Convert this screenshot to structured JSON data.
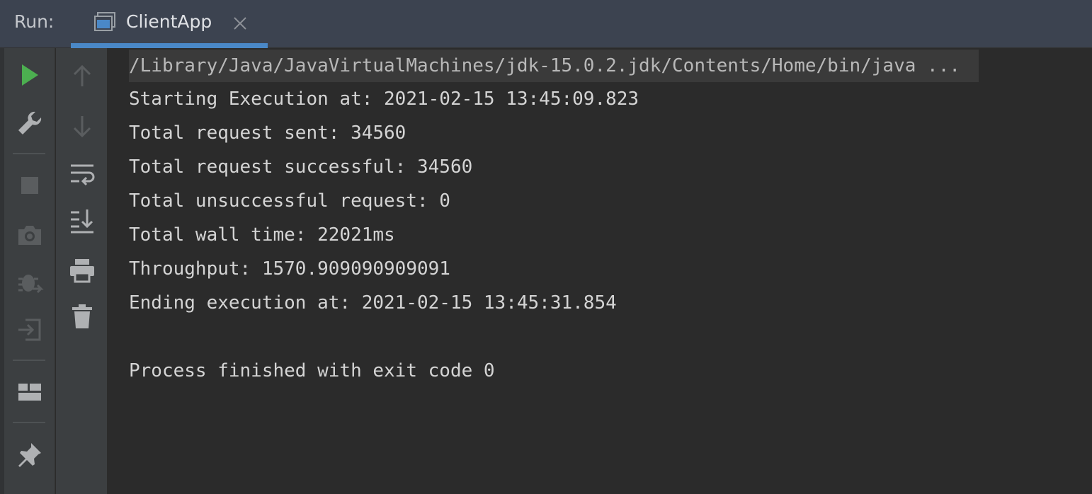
{
  "header": {
    "run_label": "Run:",
    "tab": {
      "title": "ClientApp",
      "icon": "console-window-icon",
      "close_icon": "close-icon"
    },
    "accent_color": "#4a88c7"
  },
  "toolbar_primary": [
    {
      "name": "rerun-button",
      "icon": "play-icon"
    },
    {
      "name": "edit-configuration-button",
      "icon": "wrench-icon"
    },
    {
      "name": "stop-button",
      "icon": "stop-icon"
    },
    {
      "name": "dump-threads-button",
      "icon": "camera-icon"
    },
    {
      "name": "debug-button",
      "icon": "bug-icon"
    },
    {
      "name": "exit-button",
      "icon": "exit-icon"
    },
    {
      "name": "layout-button",
      "icon": "layout-icon"
    },
    {
      "name": "pin-tab-button",
      "icon": "pin-icon"
    }
  ],
  "toolbar_secondary": [
    {
      "name": "scroll-up-button",
      "icon": "arrow-up-icon"
    },
    {
      "name": "scroll-down-button",
      "icon": "arrow-down-icon"
    },
    {
      "name": "soft-wrap-button",
      "icon": "soft-wrap-icon"
    },
    {
      "name": "scroll-to-end-button",
      "icon": "scroll-to-end-icon"
    },
    {
      "name": "print-button",
      "icon": "printer-icon"
    },
    {
      "name": "clear-all-button",
      "icon": "trash-icon"
    }
  ],
  "console": {
    "command": "/Library/Java/JavaVirtualMachines/jdk-15.0.2.jdk/Contents/Home/bin/java ...",
    "lines": [
      "Starting Execution at: 2021-02-15 13:45:09.823",
      "Total request sent: 34560",
      "Total request successful: 34560",
      "Total unsuccessful request: 0",
      "Total wall time: 22021ms",
      "Throughput: 1570.909090909091",
      "Ending execution at: 2021-02-15 13:45:31.854"
    ],
    "exit_message": "Process finished with exit code 0"
  }
}
